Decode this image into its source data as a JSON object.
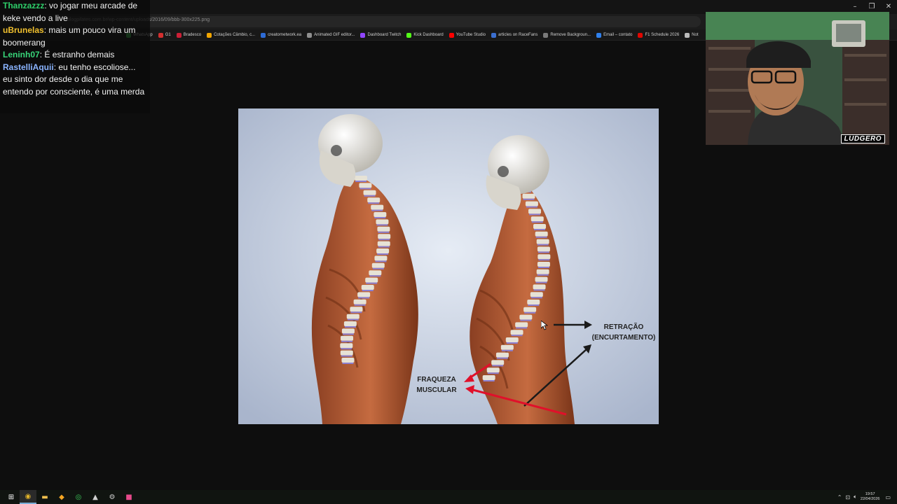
{
  "browser": {
    "url": "blogpilates.com.br/wp-content/uploads/2016/09/bbb-300x225.png",
    "window_controls": [
      "–",
      "❐",
      "✕"
    ],
    "bookmarks": [
      {
        "label": "WhatsApp",
        "icon": "whatsapp-icon",
        "color": "#3ab94a"
      },
      {
        "label": "G1",
        "icon": "g1-icon",
        "color": "#d32f2f"
      },
      {
        "label": "Bradesco",
        "icon": "bradesco-icon",
        "color": "#cc1f36"
      },
      {
        "label": "Cotações Câmbio, c...",
        "icon": "exchange-icon",
        "color": "#f2a600"
      },
      {
        "label": "creatornetwork.ea",
        "icon": "creator-icon",
        "color": "#2d6bd6"
      },
      {
        "label": "Animated GIF editor...",
        "icon": "gif-icon",
        "color": "#8f8f8f"
      },
      {
        "label": "Dashboard Twitch",
        "icon": "twitch-icon",
        "color": "#9146ff"
      },
      {
        "label": "Kick Dashboard",
        "icon": "kick-icon",
        "color": "#53fc18"
      },
      {
        "label": "YouTube Studio",
        "icon": "youtube-icon",
        "color": "#ff0000"
      },
      {
        "label": "articles on RaceFans",
        "icon": "racefans-icon",
        "color": "#3b6fd0"
      },
      {
        "label": "Remove Backgroun...",
        "icon": "remove-bg-icon",
        "color": "#7a7a7a"
      },
      {
        "label": "Email – contato",
        "icon": "email-icon",
        "color": "#2f80ed"
      },
      {
        "label": "F1 Schedule 2026",
        "icon": "f1-icon",
        "color": "#e10600"
      },
      {
        "label": "Not",
        "icon": "notion-icon",
        "color": "#bbbbbb"
      }
    ]
  },
  "chat": {
    "messages": [
      {
        "user": "Thanzazzz",
        "user_color": "#2ecf6a",
        "text": ": vo jogar meu arcade de keke vendo a live"
      },
      {
        "user": "uBrunelas",
        "user_color": "#f0c02e",
        "text": ": mais um pouco vira um boomerang"
      },
      {
        "user": "Leninh07",
        "user_color": "#38d67a",
        "text": ": É estranho demais"
      },
      {
        "user": "RastelliAquii",
        "user_color": "#8ab4ff",
        "text": ": eu tenho escoliose... eu sinto dor desde o dia que me entendo por consciente, é uma merda"
      }
    ]
  },
  "image": {
    "annotations": {
      "retracao_line1": "RETRAÇÃO",
      "retracao_line2": "(ENCURTAMENTO)",
      "fraqueza_line1": "FRAQUEZA",
      "fraqueza_line2": "MUSCULAR"
    },
    "colors": {
      "background": "#c5cee0",
      "muscle": "#b5603a",
      "bone": "#e6e2d6",
      "disc": "#8c7fd0",
      "arrow_red": "#e0102a",
      "arrow_black": "#1a1a1a"
    }
  },
  "webcam": {
    "label": "LUDGERO"
  },
  "taskbar": {
    "apps": [
      {
        "icon": "windows-start-icon"
      },
      {
        "icon": "chrome-icon"
      },
      {
        "icon": "file-explorer-icon"
      },
      {
        "icon": "blitz-icon"
      },
      {
        "icon": "whatsapp-icon"
      },
      {
        "icon": "streamlabs-icon"
      },
      {
        "icon": "settings-icon"
      },
      {
        "icon": "app-icon"
      }
    ],
    "time": "19:57",
    "date": "22/04/2026"
  }
}
